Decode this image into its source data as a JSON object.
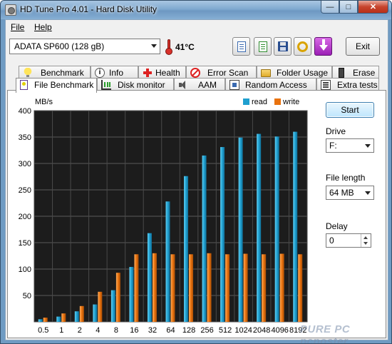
{
  "window": {
    "title": "HD Tune Pro 4.01 - Hard Disk Utility",
    "minimize": "—",
    "maximize": "□",
    "close": "✕"
  },
  "menu": [
    {
      "label": "File"
    },
    {
      "label": "Help"
    }
  ],
  "toolbar": {
    "drive": "ADATA SP600 (128 gB)",
    "temperature": "41°C",
    "exit_label": "Exit",
    "icons": [
      "copy-text-icon",
      "copy-screen-icon",
      "save-icon",
      "options-icon",
      "download-icon"
    ]
  },
  "tabs_top": [
    {
      "label": "Benchmark",
      "icon": "bulb-icon"
    },
    {
      "label": "Info",
      "icon": "info-icon"
    },
    {
      "label": "Health",
      "icon": "health-cross-icon"
    },
    {
      "label": "Error Scan",
      "icon": "error-scan-icon"
    },
    {
      "label": "Folder Usage",
      "icon": "folder-icon"
    },
    {
      "label": "Erase",
      "icon": "erase-icon"
    }
  ],
  "tabs_bottom": [
    {
      "label": "File Benchmark",
      "icon": "file-benchmark-icon",
      "active": true
    },
    {
      "label": "Disk monitor",
      "icon": "disk-monitor-icon"
    },
    {
      "label": "AAM",
      "icon": "speaker-icon"
    },
    {
      "label": "Random Access",
      "icon": "random-access-icon"
    },
    {
      "label": "Extra tests",
      "icon": "extra-tests-icon"
    }
  ],
  "controls": {
    "start_label": "Start",
    "drive_label": "Drive",
    "drive_value": "F:",
    "file_length_label": "File length",
    "file_length_value": "64 MB",
    "delay_label": "Delay",
    "delay_value": "0"
  },
  "watermark": "PURE PC  pcposter",
  "chart_data": {
    "type": "bar",
    "ylabel": "MB/s",
    "ylim": [
      0,
      400
    ],
    "yticks": [
      50,
      100,
      150,
      200,
      250,
      300,
      350,
      400
    ],
    "categories": [
      "0.5",
      "1",
      "2",
      "4",
      "8",
      "16",
      "32",
      "64",
      "128",
      "256",
      "512",
      "1024",
      "2048",
      "4096",
      "8192"
    ],
    "series": [
      {
        "name": "read",
        "color": "#1f9fcf",
        "values": [
          5,
          10,
          20,
          33,
          60,
          104,
          168,
          228,
          276,
          315,
          331,
          349,
          356,
          351,
          360
        ]
      },
      {
        "name": "write",
        "color": "#e9720e",
        "values": [
          8,
          16,
          30,
          57,
          93,
          128,
          130,
          128,
          128,
          130,
          128,
          129,
          128,
          129,
          128
        ]
      }
    ],
    "grid": true,
    "legend": "top-right",
    "background": "#1c1c1c"
  }
}
